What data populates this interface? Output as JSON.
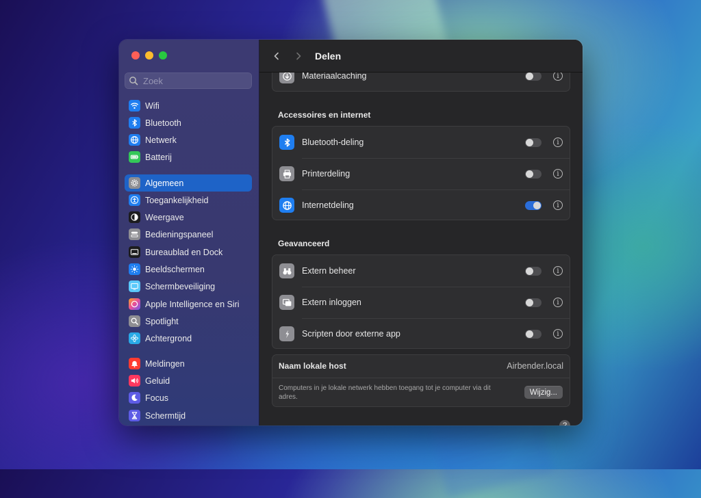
{
  "window": {
    "title": "Delen",
    "back_icon": "chevron-left-icon",
    "forward_icon": "chevron-right-icon"
  },
  "sidebar": {
    "search_placeholder": "Zoek",
    "items": [
      {
        "label": "Wifi",
        "icon": "wifi-icon",
        "color": "#1f7ef0"
      },
      {
        "label": "Bluetooth",
        "icon": "bluetooth-icon",
        "color": "#1f7ef0"
      },
      {
        "label": "Netwerk",
        "icon": "globe-icon",
        "color": "#1f7ef0"
      },
      {
        "label": "Batterij",
        "icon": "battery-icon",
        "color": "#34c759"
      },
      {
        "label": "Algemeen",
        "icon": "gear-icon",
        "color": "#8e8e93",
        "selected": true
      },
      {
        "label": "Toegankelijkheid",
        "icon": "accessibility-icon",
        "color": "#1f7ef0"
      },
      {
        "label": "Weergave",
        "icon": "appearance-icon",
        "color": "#1c1c1e"
      },
      {
        "label": "Bedieningspaneel",
        "icon": "control-center-icon",
        "color": "#8e8e93"
      },
      {
        "label": "Bureaublad en Dock",
        "icon": "dock-icon",
        "color": "#1c1c1e"
      },
      {
        "label": "Beeldschermen",
        "icon": "sun-icon",
        "color": "#1f7ef0"
      },
      {
        "label": "Schermbeveiliging",
        "icon": "screensaver-icon",
        "color": "#5ac8fa"
      },
      {
        "label": "Apple Intelligence en Siri",
        "icon": "siri-icon",
        "color": "#d86ad8"
      },
      {
        "label": "Spotlight",
        "icon": "magnifier-icon",
        "color": "#8e8e93"
      },
      {
        "label": "Achtergrond",
        "icon": "flower-icon",
        "color": "#29a9e6"
      },
      {
        "label": "Meldingen",
        "icon": "bell-icon",
        "color": "#ff3b30"
      },
      {
        "label": "Geluid",
        "icon": "speaker-icon",
        "color": "#ff375f"
      },
      {
        "label": "Focus",
        "icon": "moon-icon",
        "color": "#5e5ce6"
      },
      {
        "label": "Schermtijd",
        "icon": "hourglass-icon",
        "color": "#5e5ce6"
      }
    ]
  },
  "content": {
    "top_row": {
      "label": "Materiaalcaching",
      "icon": "download-icon",
      "enabled": false
    },
    "accessories": {
      "heading": "Accessoires en internet",
      "rows": [
        {
          "label": "Bluetooth-deling",
          "icon": "bluetooth-icon",
          "color": "#1f7ef0",
          "enabled": false
        },
        {
          "label": "Printerdeling",
          "icon": "printer-icon",
          "color": "#8e8e93",
          "enabled": false
        },
        {
          "label": "Internetdeling",
          "icon": "globe-icon",
          "color": "#1f7ef0",
          "enabled": true
        }
      ]
    },
    "advanced": {
      "heading": "Geavanceerd",
      "rows": [
        {
          "label": "Extern beheer",
          "icon": "binoculars-icon",
          "color": "#8e8e93",
          "enabled": false
        },
        {
          "label": "Extern inloggen",
          "icon": "remote-login-icon",
          "color": "#8e8e93",
          "enabled": false
        },
        {
          "label": "Scripten door externe app",
          "icon": "script-icon",
          "color": "#8e8e93",
          "enabled": false
        }
      ]
    },
    "host": {
      "label": "Naam lokale host",
      "value": "Airbender.local",
      "description": "Computers in je lokale netwerk hebben toegang tot je computer via dit adres.",
      "edit_button": "Wijzig..."
    },
    "help_button": "?"
  }
}
